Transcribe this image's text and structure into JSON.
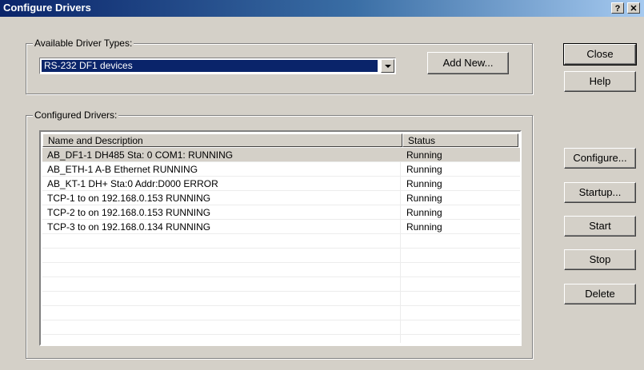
{
  "window": {
    "title": "Configure Drivers",
    "help_button": "?",
    "close_button": "✕"
  },
  "available": {
    "legend": "Available Driver Types:",
    "selected": "RS-232 DF1 devices",
    "add_new": "Add New..."
  },
  "configured": {
    "legend": "Configured Drivers:",
    "columns": [
      "Name and Description",
      "Status"
    ],
    "rows": [
      {
        "name": "AB_DF1-1  DH485 Sta: 0 COM1: RUNNING",
        "status": "Running"
      },
      {
        "name": "AB_ETH-1  A-B Ethernet  RUNNING",
        "status": "Running"
      },
      {
        "name": "AB_KT-1  DH+ Sta:0  Addr:D000  ERROR",
        "status": "Running"
      },
      {
        "name": "TCP-1 to  on 192.168.0.153 RUNNING",
        "status": "Running"
      },
      {
        "name": "TCP-2 to  on 192.168.0.153 RUNNING",
        "status": "Running"
      },
      {
        "name": "TCP-3 to  on 192.168.0.134 RUNNING",
        "status": "Running"
      }
    ]
  },
  "buttons": {
    "close": "Close",
    "help": "Help",
    "configure": "Configure...",
    "startup": "Startup...",
    "start": "Start",
    "stop": "Stop",
    "delete": "Delete"
  }
}
